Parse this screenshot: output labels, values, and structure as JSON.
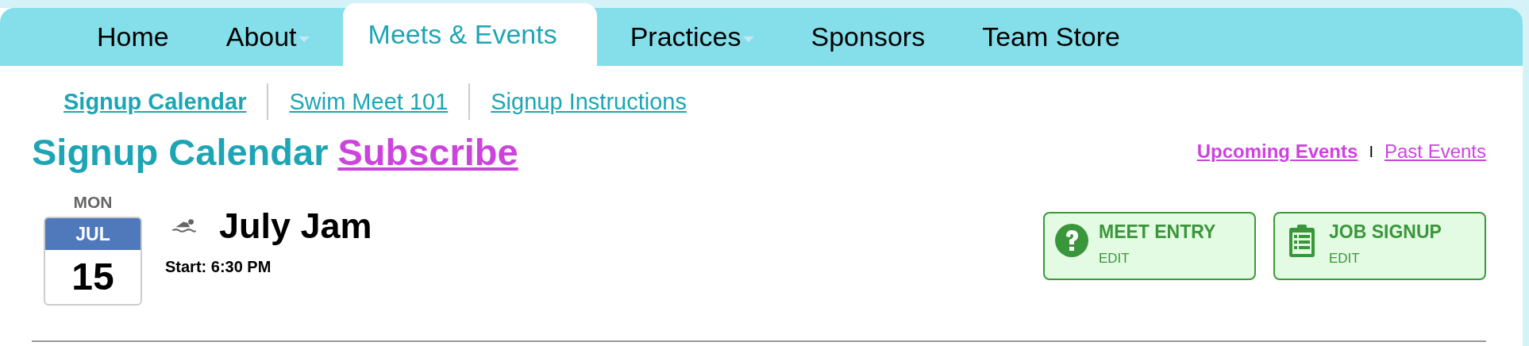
{
  "nav": [
    {
      "label": "Home",
      "selected": false,
      "dropdown": false
    },
    {
      "label": "About",
      "selected": false,
      "dropdown": true
    },
    {
      "label": "Meets & Events",
      "selected": true,
      "dropdown": false
    },
    {
      "label": "Practices",
      "selected": false,
      "dropdown": true
    },
    {
      "label": "Sponsors",
      "selected": false,
      "dropdown": false
    },
    {
      "label": "Team Store",
      "selected": false,
      "dropdown": false
    }
  ],
  "subnav": [
    {
      "label": "Signup Calendar",
      "selected": true
    },
    {
      "label": "Swim Meet 101",
      "selected": false
    },
    {
      "label": "Signup Instructions",
      "selected": false
    }
  ],
  "heading": {
    "title": "Signup Calendar",
    "link": "Subscribe"
  },
  "filters": [
    {
      "label": "Upcoming Events",
      "selected": true
    },
    {
      "label": "Past Events",
      "selected": false
    }
  ],
  "filter_separator": "I",
  "events": [
    {
      "weekday": "MON",
      "month": "JUL",
      "day": "15",
      "kind": "swim",
      "title": "July Jam",
      "start": "Start: 6:30 PM",
      "actions": [
        {
          "kind": "question",
          "label": "MEET ENTRY",
          "sub": "EDIT"
        },
        {
          "kind": "clipboard",
          "label": "JOB SIGNUP",
          "sub": "EDIT"
        }
      ]
    }
  ]
}
